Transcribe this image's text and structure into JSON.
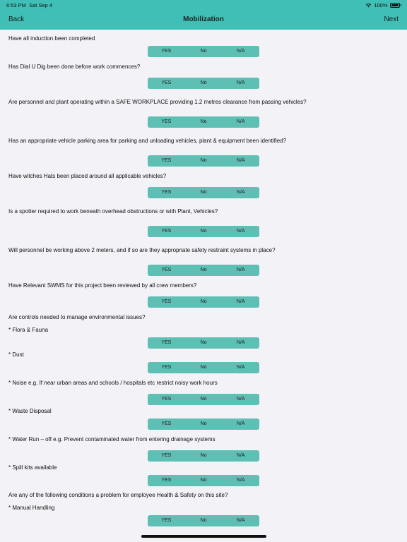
{
  "status_bar": {
    "time": "6:53 PM",
    "date": "Sat Sep 4",
    "battery": "100%"
  },
  "nav": {
    "back": "Back",
    "title": "Mobilization",
    "next": "Next"
  },
  "options": {
    "yes": "YES",
    "no": "No",
    "na": "N/A"
  },
  "questions": [
    "Have all induction been completed",
    "Has Dial U Dig been done before work commences?",
    "Are personnel and plant operating within a SAFE WORKPLACE providing 1.2 metres clearance from passing vehicles?",
    "Has an appropriate vehicle parking area for parking and unloading vehicles, plant & equipment been identified?",
    "Have witches Hats been placed around all applicable vehicles?",
    "Is a spotter required to work beneath overhead obstructions or with Plant, Vehicles?",
    "Will personnel be working above 2 meters, and if so are they appropriate safety restraint systems in place?",
    "Have Relevant SWMS for this project been reviewed by all crew members?"
  ],
  "environmental": {
    "heading": "Are controls needed to manage environmental issues?",
    "items": [
      "* Flora & Fauna",
      "* Dust",
      "* Noise e.g. If near urban areas and schools / hospitals etc restrict noisy work hours",
      "* Waste Disposal",
      "* Water Run – off e.g. Prevent contaminated water from entering drainage systems",
      "* Spill kits available"
    ]
  },
  "health": {
    "heading": "Are any of the following conditions a problem for employee Health & Safety on this site?",
    "items": [
      "* Manual Handling"
    ]
  }
}
